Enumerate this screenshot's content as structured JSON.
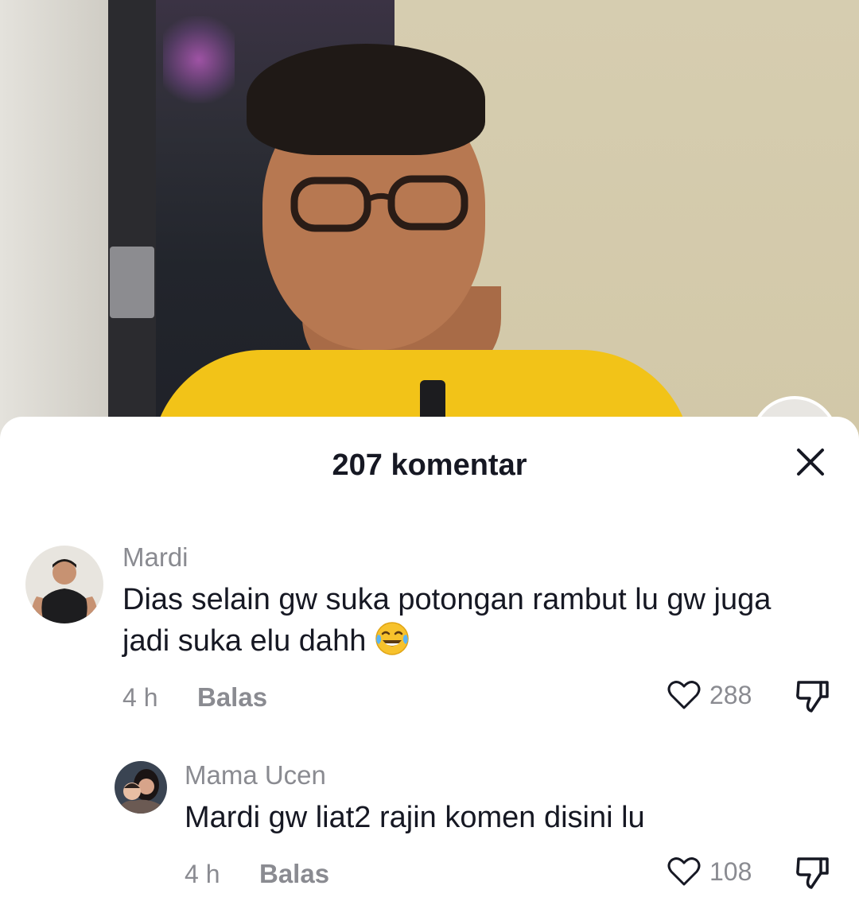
{
  "sheet": {
    "title": "207 komentar"
  },
  "comments": [
    {
      "author": "Mardi",
      "text": "Dias selain gw suka potongan rambut lu gw juga jadi suka elu dahh",
      "emoji": "face-with-tears-of-joy",
      "time": "4 h",
      "reply_label": "Balas",
      "likes": "288"
    },
    {
      "author": "Mama Ucen",
      "text": "Mardi gw liat2 rajin komen disini lu",
      "time": "4 h",
      "reply_label": "Balas",
      "likes": "108"
    }
  ],
  "colors": {
    "text_primary": "#161823",
    "text_secondary": "#8a8b91",
    "shirt": "#f2c318"
  }
}
